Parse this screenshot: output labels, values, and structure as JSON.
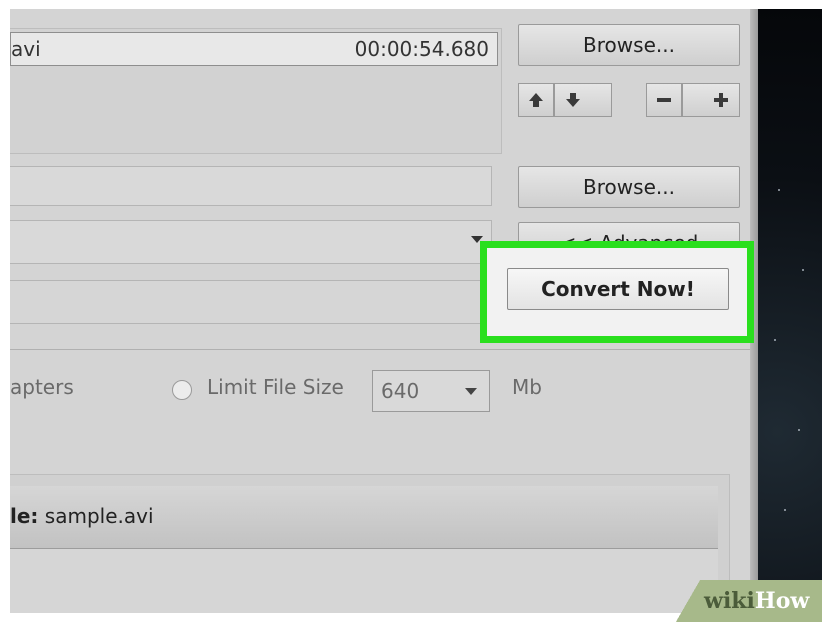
{
  "file": {
    "name": "avi",
    "duration": "00:00:54.680"
  },
  "buttons": {
    "browse_1": "Browse...",
    "browse_2": "Browse...",
    "advanced": "<< Advanced",
    "convert": "Convert Now!"
  },
  "list_controls": {
    "up_icon": "arrow-up-icon",
    "down_icon": "arrow-down-icon",
    "remove_icon": "minus-icon",
    "add_icon": "plus-icon"
  },
  "options": {
    "chapters_label": "apters",
    "limit_label": "Limit File Size",
    "limit_selected": false,
    "size_value": "640",
    "unit": "Mb"
  },
  "info": {
    "label": "le:",
    "value": "sample.avi"
  },
  "watermark": {
    "wiki": "wiki",
    "how": "How"
  },
  "colors": {
    "highlight": "#2adf1e",
    "panel": "#d4d4d4"
  }
}
